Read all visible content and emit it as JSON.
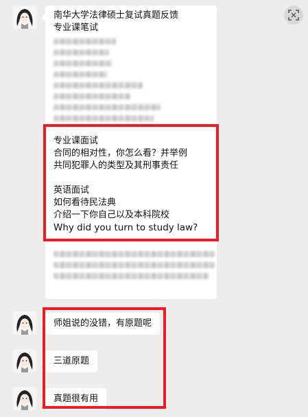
{
  "msg1": {
    "title": "南华大学法律硕士复试真题反馈",
    "section_written": "专业课笔试",
    "section_interview": "专业课面试",
    "interview_lines": [
      "合同的相对性，你怎么看？并举例",
      "共同犯罪人的类型及其刑事责任"
    ],
    "section_english": "英语面试",
    "english_lines": [
      "如何看待民法典",
      "介绍一下你自己以及本科院校",
      "Why did you turn to study law?"
    ]
  },
  "msg2": {
    "text": "师姐说的没错，有原题呢"
  },
  "msg3": {
    "text": "三道原题"
  },
  "msg4": {
    "text": "真题很有用"
  },
  "icons": {
    "avatar": "avatar-icon",
    "corner": "screenshot-frame-icon"
  },
  "colors": {
    "highlight_box": "#ee1c25",
    "background": "#ededed",
    "bubble": "#ffffff"
  }
}
